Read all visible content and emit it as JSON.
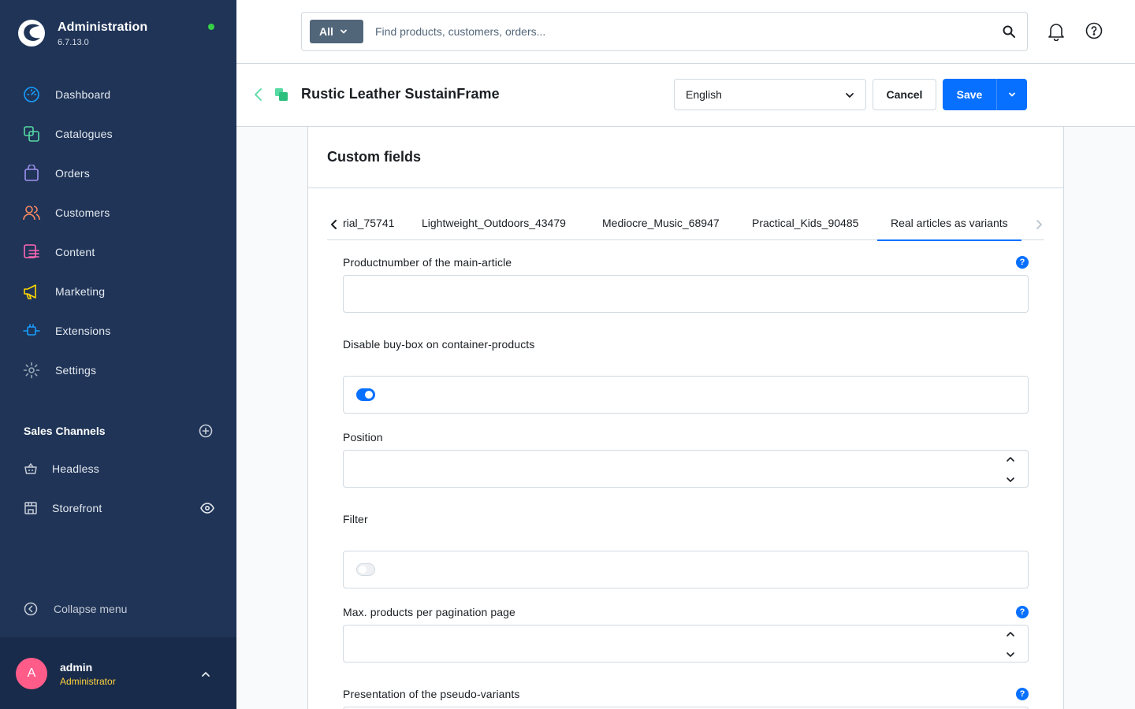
{
  "app": {
    "title": "Administration",
    "version": "6.7.13.0"
  },
  "nav": [
    {
      "label": "Dashboard",
      "icon": "dashboard-icon",
      "color": "#189eff"
    },
    {
      "label": "Catalogues",
      "icon": "catalogues-icon",
      "color": "#57d9a3"
    },
    {
      "label": "Orders",
      "icon": "orders-icon",
      "color": "#a092f0"
    },
    {
      "label": "Customers",
      "icon": "customers-icon",
      "color": "#f88962"
    },
    {
      "label": "Content",
      "icon": "content-icon",
      "color": "#ff68b4"
    },
    {
      "label": "Marketing",
      "icon": "marketing-icon",
      "color": "#ffd700"
    },
    {
      "label": "Extensions",
      "icon": "extensions-icon",
      "color": "#189eff"
    },
    {
      "label": "Settings",
      "icon": "settings-icon",
      "color": "#9aa8b5"
    }
  ],
  "sales_channels": {
    "title": "Sales Channels",
    "items": [
      {
        "label": "Headless",
        "icon": "basket-icon"
      },
      {
        "label": "Storefront",
        "icon": "storefront-icon"
      }
    ]
  },
  "collapse_label": "Collapse menu",
  "user": {
    "initial": "A",
    "name": "admin",
    "role": "Administrator"
  },
  "search": {
    "type": "All",
    "placeholder": "Find products, customers, orders..."
  },
  "header": {
    "title": "Rustic Leather SustainFrame",
    "language": "English",
    "cancel": "Cancel",
    "save": "Save"
  },
  "card": {
    "title": "Custom fields",
    "tabs": [
      {
        "label": "rial_75741",
        "active": false
      },
      {
        "label": "Lightweight_Outdoors_43479",
        "active": false
      },
      {
        "label": "Mediocre_Music_68947",
        "active": false
      },
      {
        "label": "Practical_Kids_90485",
        "active": false
      },
      {
        "label": "Real articles as variants",
        "active": true
      }
    ],
    "fields": [
      {
        "label": "Productnumber of the main-article",
        "type": "text",
        "value": "",
        "help": "?"
      },
      {
        "label": "Disable buy-box on container-products",
        "type": "switch",
        "checked": true
      },
      {
        "label": "Position",
        "type": "number",
        "value": ""
      },
      {
        "label": "Filter",
        "type": "switch",
        "checked": false
      },
      {
        "label": "Max. products per pagination page",
        "type": "number",
        "value": "",
        "help": "?"
      },
      {
        "label": "Presentation of the pseudo-variants",
        "type": "select",
        "help": "?"
      }
    ]
  },
  "colors": {
    "sidebar": "#1f3457",
    "primary": "#0870ff",
    "status_online": "#37d046",
    "avatar": "#ff5c8a",
    "role": "#ffd33d"
  }
}
